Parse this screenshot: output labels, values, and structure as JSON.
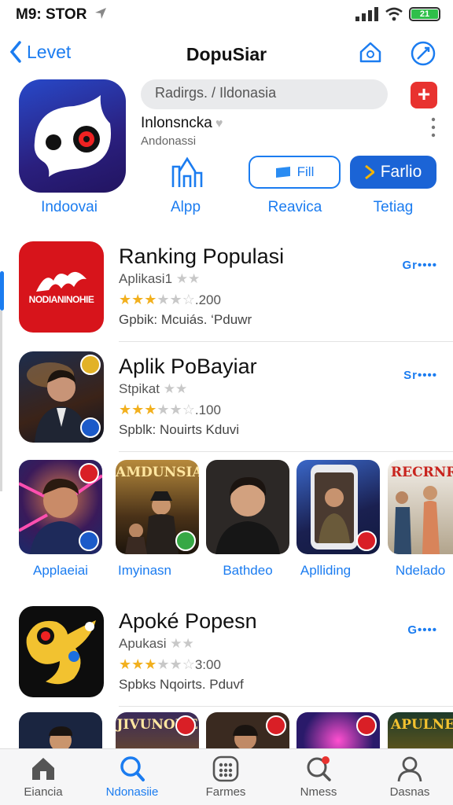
{
  "status": {
    "time": "M9: STOR",
    "battery": "21"
  },
  "nav": {
    "back_label": "Levet",
    "title": "DopuSiar"
  },
  "hero": {
    "icon_label": "Indoovai",
    "search_placeholder": "Radirgs. / Ildonasia",
    "name": "Inlonsncka",
    "subtitle": "Andonassi"
  },
  "actions": {
    "app_label": "Alpp",
    "outline_button": "Fill",
    "outline_label": "Reavica",
    "filled_button": "Farlio",
    "filled_label": "Tetiag"
  },
  "rows": [
    {
      "title": "Ranking Populasi",
      "subtitle": "Aplikasi1",
      "rating_text": ".200",
      "stars": 3,
      "desc": "Gpbik: Mcuiás. ‘Pduwr",
      "get": "Gr••••",
      "icon_text": "NODIANINOHIE"
    },
    {
      "title": "Aplik PoBayiar",
      "subtitle": "Stpikat",
      "rating_text": ".100",
      "stars": 3,
      "desc": "Spblk: Nouirts  Kduvi",
      "get": "Sr••••"
    },
    {
      "title": "Apoké Popesn",
      "subtitle": "Apukasi",
      "rating_text": "3:00",
      "stars": 3,
      "desc": "Spbks Nqoirts. Pduvf",
      "get": "G••••"
    }
  ],
  "tiles": [
    {
      "label": "Applaeiai"
    },
    {
      "label": "Imyinasn",
      "banner": "AMDUNSIA"
    },
    {
      "label": "Bathdeo"
    },
    {
      "label": "Aplliding"
    },
    {
      "label": "Ndelado",
      "banner": "RECRNR"
    }
  ],
  "bottom_tiles": [
    {
      "banner": ""
    },
    {
      "banner": "JIVUNOIIE"
    },
    {
      "banner": ""
    },
    {
      "banner": ""
    },
    {
      "banner": "APULNEA"
    }
  ],
  "tabs": [
    {
      "label": "Eiancia"
    },
    {
      "label": "Ndonasiie"
    },
    {
      "label": "Farmes"
    },
    {
      "label": "Nmess"
    },
    {
      "label": "Dasnas"
    }
  ],
  "colors": {
    "accent": "#1b7cf0",
    "red": "#e8322f",
    "star": "#f2b01e"
  }
}
